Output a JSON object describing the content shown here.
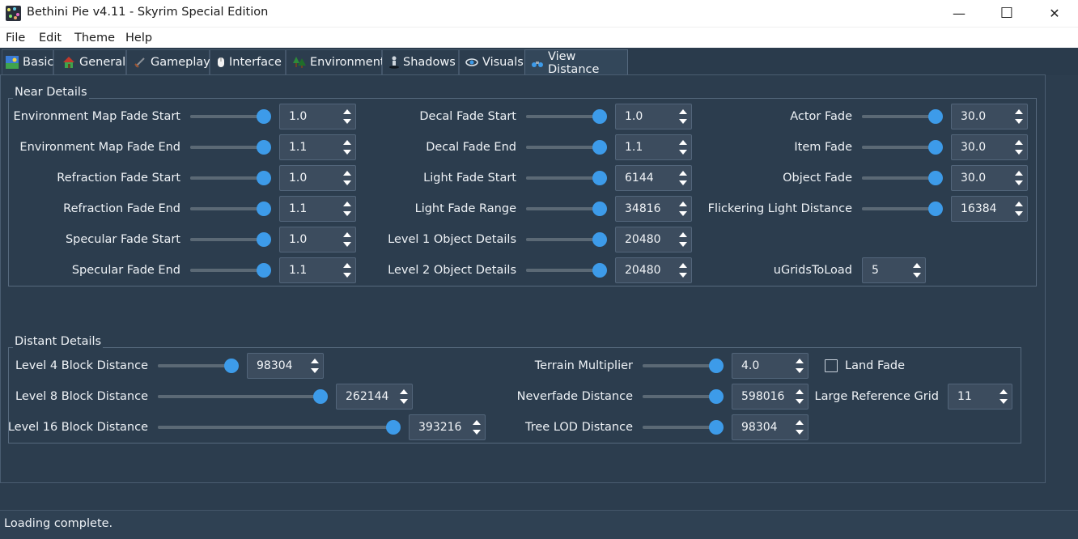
{
  "window": {
    "title": "Bethini Pie v4.11 - Skyrim Special Edition",
    "minimize_glyph": "—",
    "maximize_glyph": "☐",
    "close_glyph": "✕"
  },
  "menu": {
    "items": [
      "File",
      "Edit",
      "Theme",
      "Help"
    ]
  },
  "tabs": [
    {
      "label": "Basic",
      "icon": "landscape-icon",
      "active": false
    },
    {
      "label": "General",
      "icon": "house-icon",
      "active": false
    },
    {
      "label": "Gameplay",
      "icon": "sword-icon",
      "active": false
    },
    {
      "label": "Interface",
      "icon": "mouse-icon",
      "active": false
    },
    {
      "label": "Environment",
      "icon": "trees-icon",
      "active": false
    },
    {
      "label": "Shadows",
      "icon": "figure-icon",
      "active": false
    },
    {
      "label": "Visuals",
      "icon": "eye-icon",
      "active": false
    },
    {
      "label": "View Distance",
      "icon": "binoculars-icon",
      "active": true
    }
  ],
  "near": {
    "title": "Near Details",
    "col1": [
      {
        "label": "Environment Map Fade Start",
        "value": "1.0",
        "level": 1.0
      },
      {
        "label": "Environment Map Fade End",
        "value": "1.1",
        "level": 1.0
      },
      {
        "label": "Refraction Fade Start",
        "value": "1.0",
        "level": 1.0
      },
      {
        "label": "Refraction Fade End",
        "value": "1.1",
        "level": 1.0
      },
      {
        "label": "Specular Fade Start",
        "value": "1.0",
        "level": 1.0
      },
      {
        "label": "Specular Fade End",
        "value": "1.1",
        "level": 1.0
      }
    ],
    "col2": [
      {
        "label": "Decal Fade Start",
        "value": "1.0",
        "level": 1.0
      },
      {
        "label": "Decal Fade End",
        "value": "1.1",
        "level": 1.0
      },
      {
        "label": "Light Fade Start",
        "value": "6144",
        "level": 1.0
      },
      {
        "label": "Light Fade Range",
        "value": "34816",
        "level": 1.0
      },
      {
        "label": "Level 1 Object Details",
        "value": "20480",
        "level": 1.0
      },
      {
        "label": "Level 2 Object Details",
        "value": "20480",
        "level": 1.0
      }
    ],
    "col3": [
      {
        "label": "Actor Fade",
        "value": "30.0",
        "level": 1.0
      },
      {
        "label": "Item Fade",
        "value": "30.0",
        "level": 1.0
      },
      {
        "label": "Object Fade",
        "value": "30.0",
        "level": 1.0
      },
      {
        "label": "Flickering Light Distance",
        "value": "16384",
        "level": 1.0
      }
    ],
    "ugrids": {
      "label": "uGridsToLoad",
      "value": "5"
    }
  },
  "distant": {
    "title": "Distant Details",
    "col1": [
      {
        "label": "Level 4 Block Distance",
        "value": "98304",
        "level": 1.0
      },
      {
        "label": "Level 8 Block Distance",
        "value": "262144",
        "level": 1.0
      },
      {
        "label": "Level 16 Block Distance",
        "value": "393216",
        "level": 1.0
      }
    ],
    "col2": [
      {
        "label": "Terrain Multiplier",
        "value": "4.0",
        "level": 1.0
      },
      {
        "label": "Neverfade Distance",
        "value": "598016",
        "level": 1.0
      },
      {
        "label": "Tree LOD Distance",
        "value": "98304",
        "level": 1.0
      }
    ],
    "land_fade": {
      "label": "Land Fade",
      "checked": false
    },
    "large_ref": {
      "label": "Large Reference Grid",
      "value": "11"
    }
  },
  "status": {
    "text": "Loading complete."
  },
  "colors": {
    "background": "#2c3d4e",
    "accent": "#3d9be9",
    "titlebar": "#ffffff"
  }
}
